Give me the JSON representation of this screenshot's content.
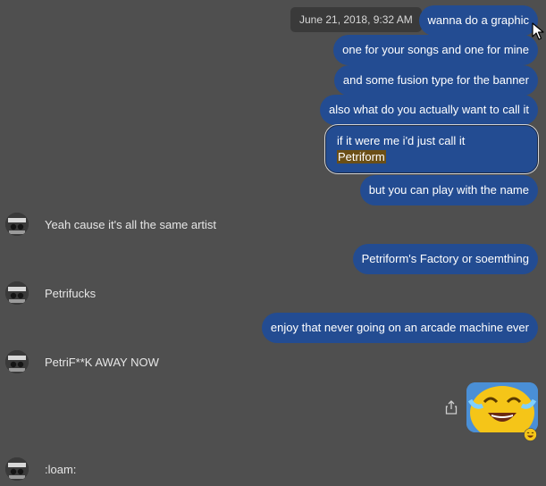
{
  "timestamp": "June 21, 2018, 9:32 AM",
  "outgoing": [
    "wanna do a graphic",
    "one for your songs and one for mine",
    "and some fusion type for the banner",
    "also what do you actually want to call it",
    "if it were me i'd just call it",
    "Petriform",
    "but you can play with the name",
    "Petriform's Factory or soemthing",
    "enjoy that never going on an arcade machine ever"
  ],
  "incoming": [
    "Yeah cause it's all the same artist",
    "Petrifucks",
    "PetriF**K AWAY NOW",
    ":loam:"
  ],
  "icons": {
    "share": "share-icon",
    "sticker": "laughing-crying-sticker",
    "reaction": "laughing-face-reaction",
    "cursor": "mouse-pointer-icon"
  },
  "colors": {
    "background": "#4f4f4f",
    "outgoing_bubble": "#234c92",
    "highlight": "#6b4f16"
  }
}
